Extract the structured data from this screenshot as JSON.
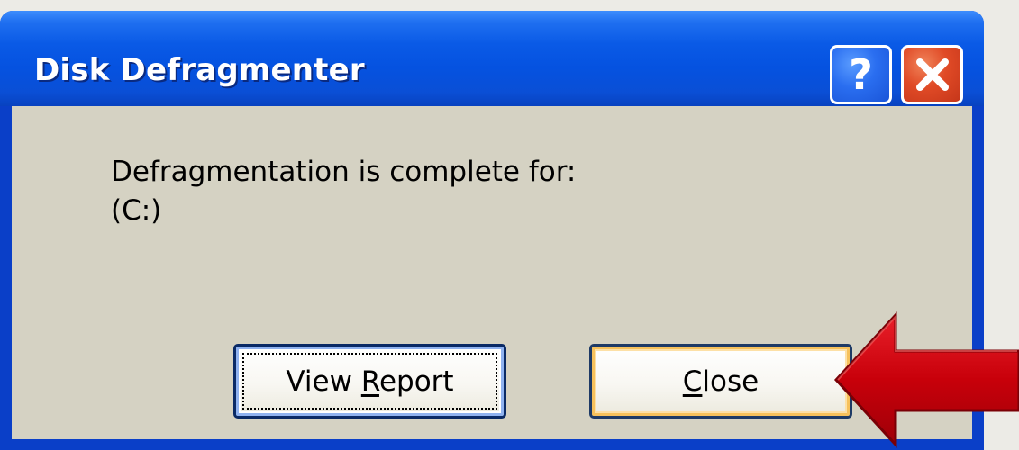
{
  "dialog": {
    "title": "Disk Defragmenter",
    "help_symbol": "?",
    "message_line_1": "Defragmentation is complete for:",
    "message_line_2": "(C:)",
    "view_report": {
      "pre": "View ",
      "accel": "R",
      "post": "eport"
    },
    "close": {
      "pre": "",
      "accel": "C",
      "post": "lose"
    }
  },
  "colors": {
    "titlebar": "#0552e0",
    "client_bg": "#d5d2c3",
    "close_button_red": "#e04a26",
    "help_button_blue": "#2a6ef0",
    "annotation_arrow": "#c8000a"
  },
  "icons": {
    "help": "question-mark-icon",
    "close": "close-icon",
    "annotation": "red-arrow-pointing-left"
  }
}
